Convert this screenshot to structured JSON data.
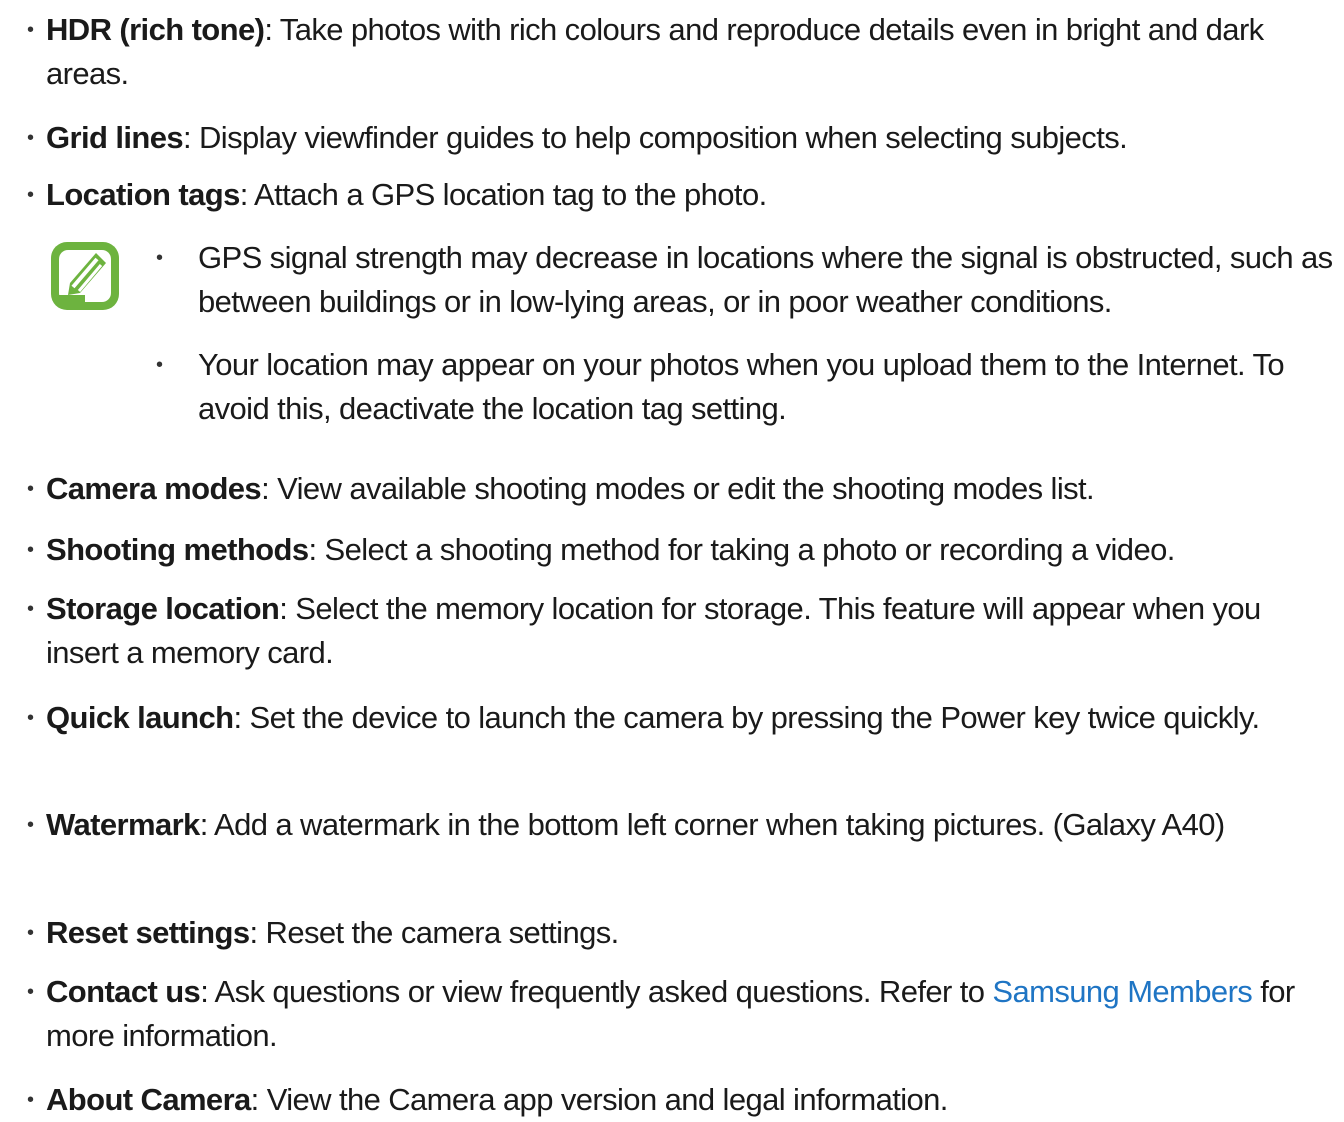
{
  "items_top": [
    {
      "term": "HDR (rich tone)",
      "desc": ": Take photos with rich colours and reproduce details even in bright and dark areas."
    },
    {
      "term": "Grid lines",
      "desc": ": Display viewfinder guides to help composition when selecting subjects."
    },
    {
      "term": "Location tags",
      "desc": ": Attach a GPS location tag to the photo."
    }
  ],
  "note": {
    "icon": "note-pen-icon",
    "icon_color": "#6db33f",
    "bullets": [
      "GPS signal strength may decrease in locations where the signal is obstructed, such as between buildings or in low-lying areas, or in poor weather conditions.",
      "Your location may appear on your photos when you upload them to the Internet. To avoid this, deactivate the location tag setting."
    ]
  },
  "items_bottom": [
    {
      "term": "Camera modes",
      "desc": ": View available shooting modes or edit the shooting modes list."
    },
    {
      "term": "Shooting methods",
      "desc": ": Select a shooting method for taking a photo or recording a video."
    },
    {
      "term": "Storage location",
      "desc": ": Select the memory location for storage. This feature will appear when you insert a memory card."
    },
    {
      "term": "Quick launch",
      "desc": ": Set the device to launch the camera by pressing the Power key twice quickly."
    },
    {
      "term": "Watermark",
      "desc": ": Add a watermark in the bottom left corner when taking pictures. (Galaxy A40)"
    },
    {
      "term": "Reset settings",
      "desc": ": Reset the camera settings."
    },
    {
      "term": "Contact us",
      "desc": ": Ask questions or view frequently asked questions. Refer to ",
      "link": "Samsung Members",
      "desc_after": " for more information."
    },
    {
      "term": "About Camera",
      "desc": ": View the Camera app version and legal information."
    }
  ],
  "bullet_char": "•",
  "link_color": "#1f75c4"
}
